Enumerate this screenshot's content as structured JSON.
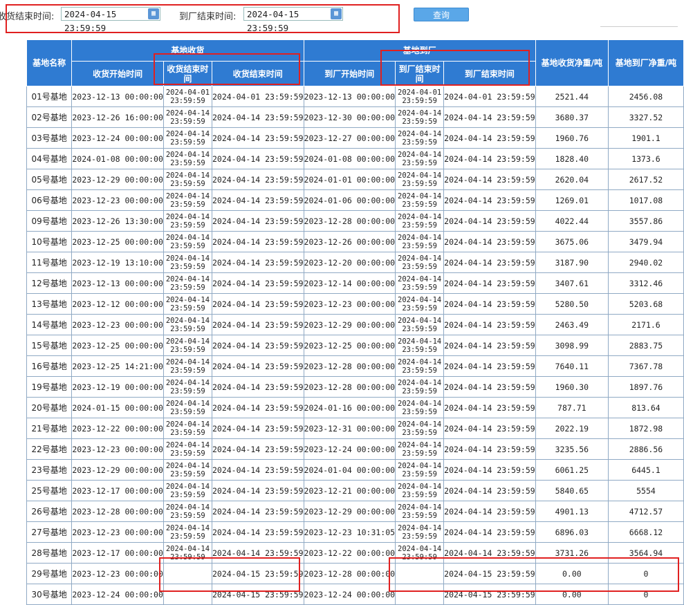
{
  "filter": {
    "end_label": "收货结束时间:",
    "end_value": "2024-04-15 23:59:59",
    "factory_end_label": "到厂结束时间:",
    "factory_end_value": "2024-04-15 23:59:59",
    "query_label": "查询",
    "calendar_icon": "calendar-icon"
  },
  "table": {
    "headers": {
      "name": "基地名称",
      "group_recv": "基地收货",
      "recv_start": "收货开始时间",
      "recv_end_a": "收货结束时间",
      "recv_end_b": "收货结束时间",
      "group_arrive": "基地到厂",
      "arrive_start": "到厂开始时间",
      "arrive_end_a": "到厂结束时间",
      "arrive_end_b": "到厂结束时间",
      "recv_net": "基地收货净重/吨",
      "arrive_net": "基地到厂净重/吨"
    },
    "rows": [
      [
        "01号基地",
        "2023-12-13 00:00:00",
        "2024-04-01 23:59:59",
        "2024-04-01 23:59:59",
        "2023-12-13 00:00:00",
        "2024-04-01 23:59:59",
        "2024-04-01 23:59:59",
        "2521.44",
        "2456.08"
      ],
      [
        "02号基地",
        "2023-12-26 16:00:00",
        "2024-04-14 23:59:59",
        "2024-04-14 23:59:59",
        "2023-12-30 00:00:00",
        "2024-04-14 23:59:59",
        "2024-04-14 23:59:59",
        "3680.37",
        "3327.52"
      ],
      [
        "03号基地",
        "2023-12-24 00:00:00",
        "2024-04-14 23:59:59",
        "2024-04-14 23:59:59",
        "2023-12-27 00:00:00",
        "2024-04-14 23:59:59",
        "2024-04-14 23:59:59",
        "1960.76",
        "1901.1"
      ],
      [
        "04号基地",
        "2024-01-08 00:00:00",
        "2024-04-14 23:59:59",
        "2024-04-14 23:59:59",
        "2024-01-08 00:00:00",
        "2024-04-14 23:59:59",
        "2024-04-14 23:59:59",
        "1828.40",
        "1373.6"
      ],
      [
        "05号基地",
        "2023-12-29 00:00:00",
        "2024-04-14 23:59:59",
        "2024-04-14 23:59:59",
        "2024-01-01 00:00:00",
        "2024-04-14 23:59:59",
        "2024-04-14 23:59:59",
        "2620.04",
        "2617.52"
      ],
      [
        "06号基地",
        "2023-12-23 00:00:00",
        "2024-04-14 23:59:59",
        "2024-04-14 23:59:59",
        "2024-01-06 00:00:00",
        "2024-04-14 23:59:59",
        "2024-04-14 23:59:59",
        "1269.01",
        "1017.08"
      ],
      [
        "09号基地",
        "2023-12-26 13:30:00",
        "2024-04-14 23:59:59",
        "2024-04-14 23:59:59",
        "2023-12-28 00:00:00",
        "2024-04-14 23:59:59",
        "2024-04-14 23:59:59",
        "4022.44",
        "3557.86"
      ],
      [
        "10号基地",
        "2023-12-25 00:00:00",
        "2024-04-14 23:59:59",
        "2024-04-14 23:59:59",
        "2023-12-26 00:00:00",
        "2024-04-14 23:59:59",
        "2024-04-14 23:59:59",
        "3675.06",
        "3479.94"
      ],
      [
        "11号基地",
        "2023-12-19 13:10:00",
        "2024-04-14 23:59:59",
        "2024-04-14 23:59:59",
        "2023-12-20 00:00:00",
        "2024-04-14 23:59:59",
        "2024-04-14 23:59:59",
        "3187.90",
        "2940.02"
      ],
      [
        "12号基地",
        "2023-12-13 00:00:00",
        "2024-04-14 23:59:59",
        "2024-04-14 23:59:59",
        "2023-12-14 00:00:00",
        "2024-04-14 23:59:59",
        "2024-04-14 23:59:59",
        "3407.61",
        "3312.46"
      ],
      [
        "13号基地",
        "2023-12-12 00:00:00",
        "2024-04-14 23:59:59",
        "2024-04-14 23:59:59",
        "2023-12-23 00:00:00",
        "2024-04-14 23:59:59",
        "2024-04-14 23:59:59",
        "5280.50",
        "5203.68"
      ],
      [
        "14号基地",
        "2023-12-23 00:00:00",
        "2024-04-14 23:59:59",
        "2024-04-14 23:59:59",
        "2023-12-29 00:00:00",
        "2024-04-14 23:59:59",
        "2024-04-14 23:59:59",
        "2463.49",
        "2171.6"
      ],
      [
        "15号基地",
        "2023-12-25 00:00:00",
        "2024-04-14 23:59:59",
        "2024-04-14 23:59:59",
        "2023-12-25 00:00:00",
        "2024-04-14 23:59:59",
        "2024-04-14 23:59:59",
        "3098.99",
        "2883.75"
      ],
      [
        "16号基地",
        "2023-12-25 14:21:00",
        "2024-04-14 23:59:59",
        "2024-04-14 23:59:59",
        "2023-12-28 00:00:00",
        "2024-04-14 23:59:59",
        "2024-04-14 23:59:59",
        "7640.11",
        "7367.78"
      ],
      [
        "19号基地",
        "2023-12-19 00:00:00",
        "2024-04-14 23:59:59",
        "2024-04-14 23:59:59",
        "2023-12-28 00:00:00",
        "2024-04-14 23:59:59",
        "2024-04-14 23:59:59",
        "1960.30",
        "1897.76"
      ],
      [
        "20号基地",
        "2024-01-15 00:00:00",
        "2024-04-14 23:59:59",
        "2024-04-14 23:59:59",
        "2024-01-16 00:00:00",
        "2024-04-14 23:59:59",
        "2024-04-14 23:59:59",
        "787.71",
        "813.64"
      ],
      [
        "21号基地",
        "2023-12-22 00:00:00",
        "2024-04-14 23:59:59",
        "2024-04-14 23:59:59",
        "2023-12-31 00:00:00",
        "2024-04-14 23:59:59",
        "2024-04-14 23:59:59",
        "2022.19",
        "1872.98"
      ],
      [
        "22号基地",
        "2023-12-23 00:00:00",
        "2024-04-14 23:59:59",
        "2024-04-14 23:59:59",
        "2023-12-24 00:00:00",
        "2024-04-14 23:59:59",
        "2024-04-14 23:59:59",
        "3235.56",
        "2886.56"
      ],
      [
        "23号基地",
        "2023-12-29 00:00:00",
        "2024-04-14 23:59:59",
        "2024-04-14 23:59:59",
        "2024-01-04 00:00:00",
        "2024-04-14 23:59:59",
        "2024-04-14 23:59:59",
        "6061.25",
        "6445.1"
      ],
      [
        "25号基地",
        "2023-12-17 00:00:00",
        "2024-04-14 23:59:59",
        "2024-04-14 23:59:59",
        "2023-12-21 00:00:00",
        "2024-04-14 23:59:59",
        "2024-04-14 23:59:59",
        "5840.65",
        "5554"
      ],
      [
        "26号基地",
        "2023-12-28 00:00:00",
        "2024-04-14 23:59:59",
        "2024-04-14 23:59:59",
        "2023-12-29 00:00:00",
        "2024-04-14 23:59:59",
        "2024-04-14 23:59:59",
        "4901.13",
        "4712.57"
      ],
      [
        "27号基地",
        "2023-12-23 00:00:00",
        "2024-04-14 23:59:59",
        "2024-04-14 23:59:59",
        "2023-12-23 10:31:05",
        "2024-04-14 23:59:59",
        "2024-04-14 23:59:59",
        "6896.03",
        "6668.12"
      ],
      [
        "28号基地",
        "2023-12-17 00:00:00",
        "2024-04-14 23:59:59",
        "2024-04-14 23:59:59",
        "2023-12-22 00:00:00",
        "2024-04-14 23:59:59",
        "2024-04-14 23:59:59",
        "3731.26",
        "3564.94"
      ],
      [
        "29号基地",
        "2023-12-23 00:00:00",
        "",
        "2024-04-15 23:59:59",
        "2023-12-28 00:00:00",
        "",
        "2024-04-15 23:59:59",
        "0.00",
        "0"
      ],
      [
        "30号基地",
        "2023-12-24 00:00:00",
        "",
        "2024-04-15 23:59:59",
        "2023-12-24 00:00:00",
        "",
        "2024-04-15 23:59:59",
        "0.00",
        "0"
      ]
    ]
  }
}
